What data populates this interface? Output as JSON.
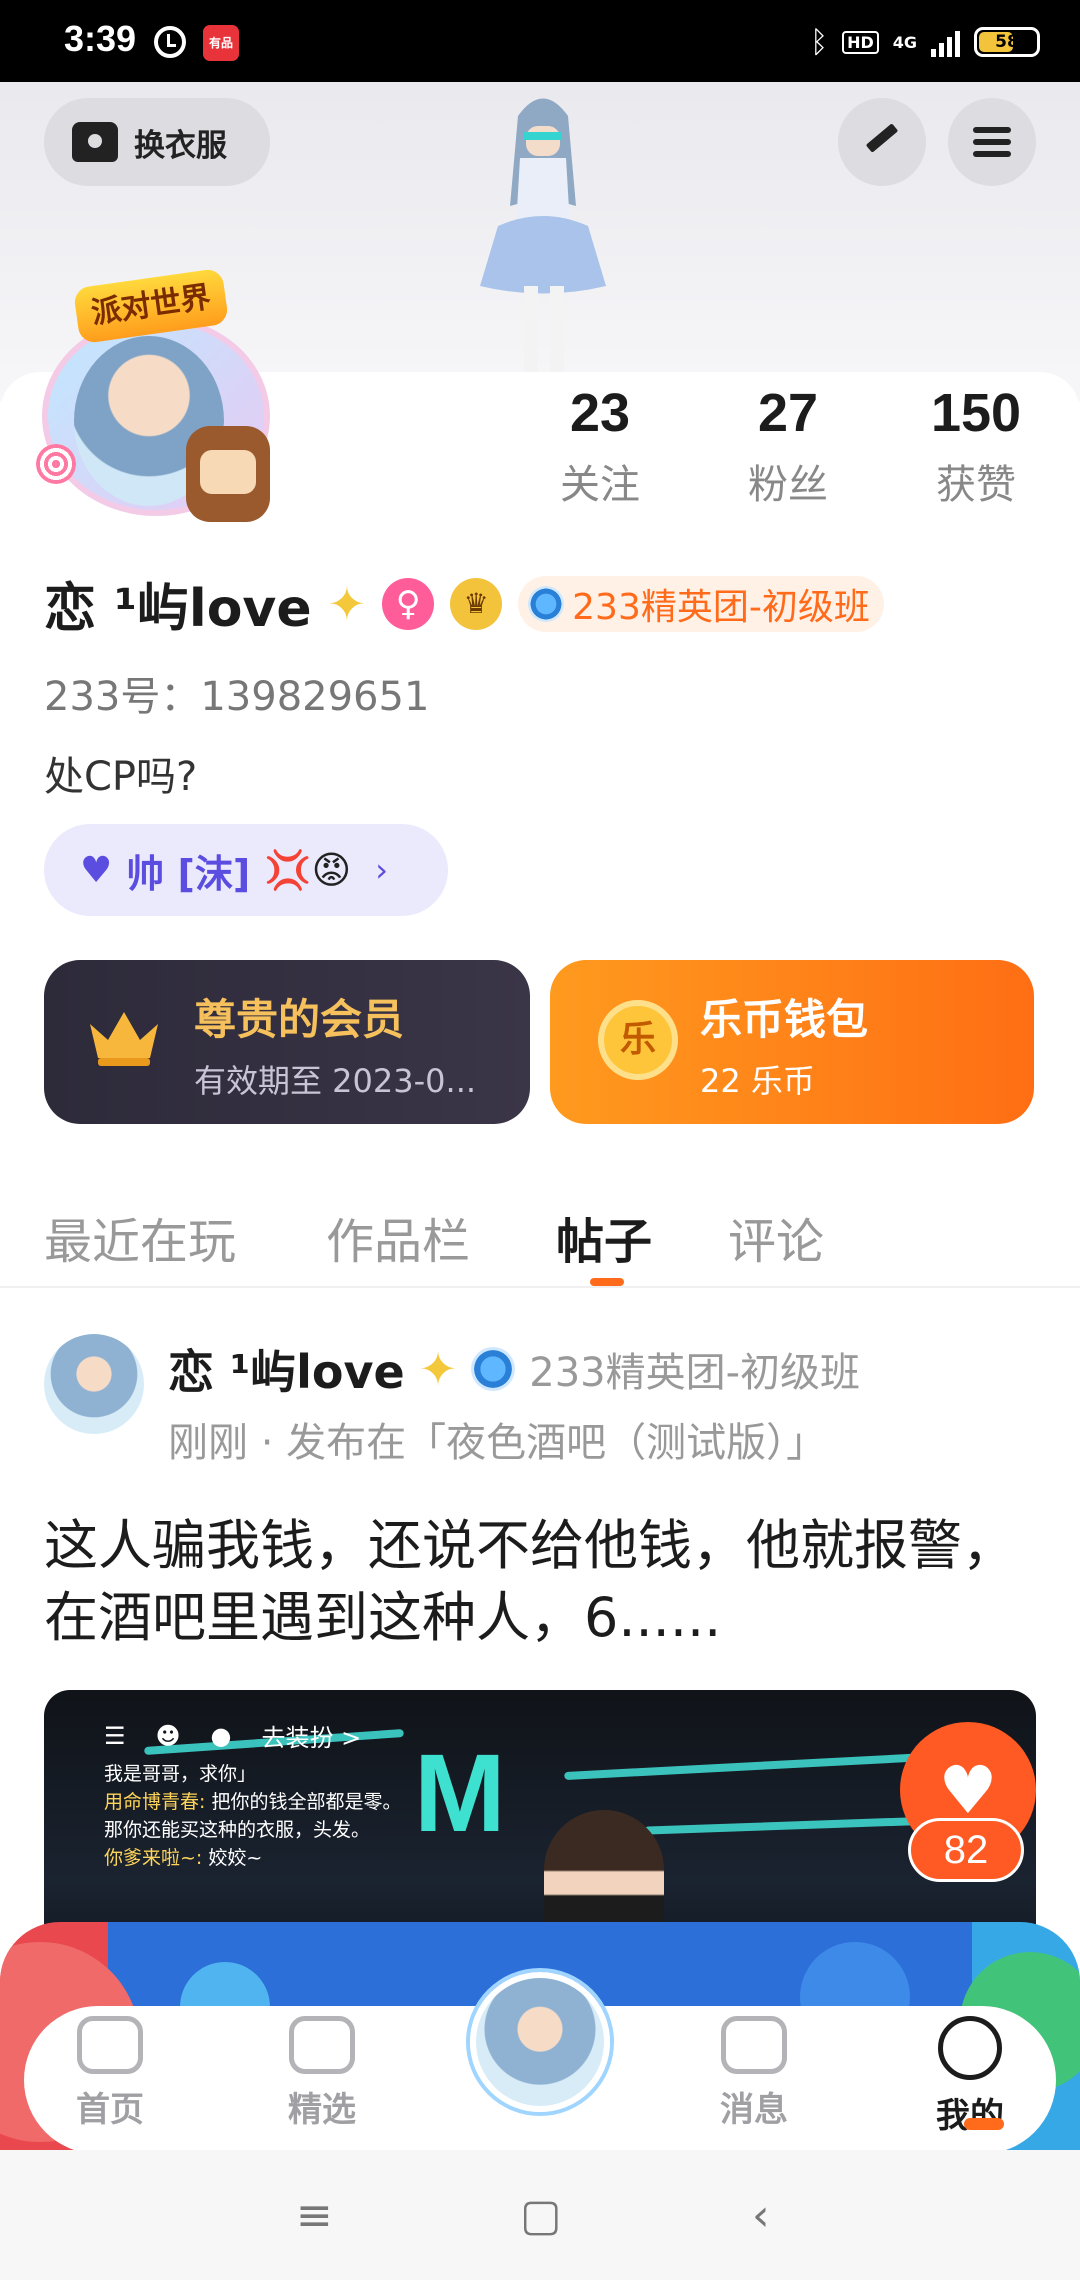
{
  "status_bar": {
    "time": "3:39",
    "app_icon_text": "有品",
    "hd_label": "HD",
    "network": "4G",
    "battery": "58",
    "battery_color": "#f3c33b"
  },
  "header": {
    "outfit_button_label": "换衣服",
    "edit_icon": "pencil-icon",
    "menu_icon": "hamburger-icon"
  },
  "profile": {
    "avatar_badge_text": "派对世界",
    "stats": [
      {
        "value": "23",
        "label": "关注"
      },
      {
        "value": "27",
        "label": "粉丝"
      },
      {
        "value": "150",
        "label": "获赞"
      }
    ],
    "name": "恋 ¹屿love",
    "gender_symbol": "♀",
    "crown_symbol": "♛",
    "elite_tag": "233精英团-初级班",
    "uid": "233号：139829651",
    "bio": "处CP吗?",
    "cp": {
      "heart": "♥",
      "name": "帅 [沫]",
      "emoji": "💢😡",
      "chevron": "›"
    }
  },
  "cards": {
    "vip": {
      "title": "尊贵的会员",
      "subtitle": "有效期至 2023-0..."
    },
    "wallet": {
      "coin_char": "乐",
      "title": "乐币钱包",
      "subtitle": "22 乐币"
    }
  },
  "tabs": [
    {
      "label": "最近在玩",
      "active": false
    },
    {
      "label": "作品栏",
      "active": false
    },
    {
      "label": "帖子",
      "active": true
    },
    {
      "label": "评论",
      "active": false
    }
  ],
  "post": {
    "author": "恋 ¹屿love",
    "author_rank": "233精英团-初级班",
    "meta": "刚刚 · 发布在「夜色酒吧（测试版）」",
    "text": "这人骗我钱，还说不给他钱，他就报警，在酒吧里遇到这种人，6......",
    "image": {
      "toolbar_text": "去装扮 >",
      "chat_lines": [
        {
          "speaker": "",
          "text": "我是哥哥，求你」"
        },
        {
          "speaker": "用命博青春:",
          "text": " 把你的钱全部都是零。"
        },
        {
          "speaker": "",
          "text": "那你还能买这种的衣服，头发。"
        },
        {
          "speaker": "你爹来啦~:",
          "text": " 姣姣~"
        }
      ],
      "sign_text": "M",
      "emojis": "😀😀😊😊😉😍"
    },
    "like_count": "82"
  },
  "bottom_nav": {
    "items": [
      {
        "label": "首页",
        "icon": "gamepad-icon"
      },
      {
        "label": "精选",
        "icon": "star-bookmark-icon"
      },
      {
        "label": "消息",
        "icon": "chat-bubble-icon"
      },
      {
        "label": "我的",
        "icon": "smile-face-icon"
      }
    ]
  },
  "system_nav": {
    "recent": "≡",
    "home": "▢",
    "back": "‹"
  }
}
